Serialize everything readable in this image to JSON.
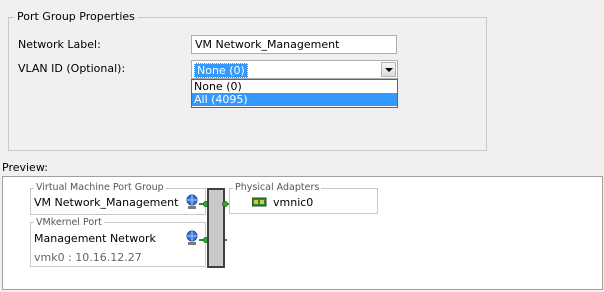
{
  "port_group": {
    "title": "Port Group Properties",
    "network_label": {
      "label": "Network Label:",
      "value": "VM Network_Management"
    },
    "vlan_id": {
      "label": "VLAN ID (Optional):",
      "value": "None (0)",
      "options": [
        "None (0)",
        "All (4095)"
      ],
      "highlighted_option": "All (4095)"
    }
  },
  "preview": {
    "label": "Preview:",
    "vm_port_group": {
      "title": "Virtual Machine Port Group",
      "name": "VM Network_Management"
    },
    "vmkernel_port": {
      "title": "VMkernel Port",
      "name": "Management Network",
      "ip": "vmk0 : 10.16.12.27"
    },
    "physical_adapters": {
      "title": "Physical Adapters",
      "adapter": "vmnic0"
    }
  },
  "colors": {
    "selection": "#3399ff",
    "link_green": "#33aa33",
    "switch_border": "#404040"
  },
  "icons": [
    "network-globe-icon",
    "nic-card-icon",
    "combo-arrow-icon"
  ]
}
